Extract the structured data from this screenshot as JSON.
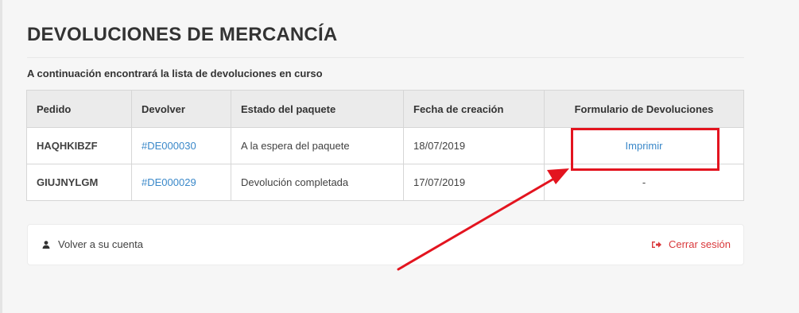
{
  "page": {
    "title": "DEVOLUCIONES DE MERCANCÍA",
    "intro": "A continuación encontrará la lista de devoluciones en curso"
  },
  "table": {
    "headers": [
      "Pedido",
      "Devolver",
      "Estado del paquete",
      "Fecha de creación",
      "Formulario de Devoluciones"
    ],
    "rows": [
      {
        "pedido": "HAQHKIBZF",
        "devolver": "#DE000030",
        "estado": "A la espera del paquete",
        "fecha": "18/07/2019",
        "formulario": "Imprimir"
      },
      {
        "pedido": "GIUJNYLGM",
        "devolver": "#DE000029",
        "estado": "Devolución completada",
        "fecha": "17/07/2019",
        "formulario": "-"
      }
    ]
  },
  "footer": {
    "back_label": "Volver a su cuenta",
    "back_icon": "user-icon",
    "logout_label": "Cerrar sesión",
    "logout_icon": "sign-out-icon"
  },
  "colors": {
    "link": "#3a88c9",
    "logout": "#d9383b",
    "annotation": "#e3141f"
  }
}
